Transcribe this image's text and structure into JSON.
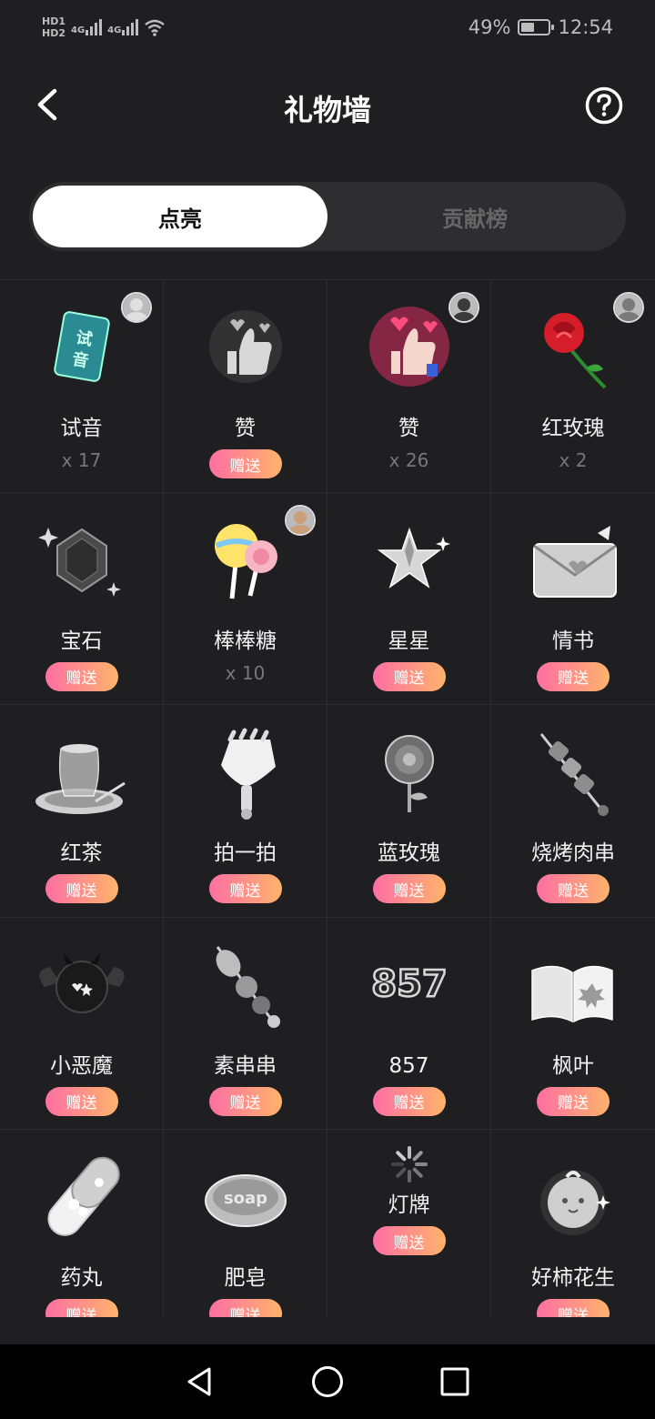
{
  "status_bar": {
    "hd1": "HD1",
    "hd2": "HD2",
    "sig1": "4G",
    "sig2": "4G",
    "battery_text": "49%",
    "battery_level": 0.49,
    "time": "12:54"
  },
  "header": {
    "title": "礼物墙",
    "back_icon": "chevron-left-icon",
    "help_icon": "question-circle-icon"
  },
  "tabs": [
    {
      "label": "点亮",
      "active": true
    },
    {
      "label": "贡献榜",
      "active": false
    }
  ],
  "send_label": "赠送",
  "gifts": [
    {
      "name": "试音",
      "count": "x 17",
      "icon": "audition-card-icon",
      "has_avatar": true
    },
    {
      "name": "赞",
      "count": "",
      "icon": "thumbs-up-gray-icon",
      "has_avatar": false
    },
    {
      "name": "赞",
      "count": "x 26",
      "icon": "thumbs-up-pink-icon",
      "has_avatar": true
    },
    {
      "name": "红玫瑰",
      "count": "x 2",
      "icon": "red-rose-icon",
      "has_avatar": true
    },
    {
      "name": "宝石",
      "count": "",
      "icon": "gem-icon",
      "has_avatar": false
    },
    {
      "name": "棒棒糖",
      "count": "x 10",
      "icon": "lollipop-icon",
      "has_avatar": true
    },
    {
      "name": "星星",
      "count": "",
      "icon": "star-icon",
      "has_avatar": false
    },
    {
      "name": "情书",
      "count": "",
      "icon": "love-letter-icon",
      "has_avatar": false
    },
    {
      "name": "红茶",
      "count": "",
      "icon": "tea-cup-icon",
      "has_avatar": false
    },
    {
      "name": "拍一拍",
      "count": "",
      "icon": "clapper-hand-icon",
      "has_avatar": false
    },
    {
      "name": "蓝玫瑰",
      "count": "",
      "icon": "blue-rose-icon",
      "has_avatar": false
    },
    {
      "name": "烧烤肉串",
      "count": "",
      "icon": "meat-skewer-icon",
      "has_avatar": false
    },
    {
      "name": "小恶魔",
      "count": "",
      "icon": "little-devil-icon",
      "has_avatar": false
    },
    {
      "name": "素串串",
      "count": "",
      "icon": "veggie-skewer-icon",
      "has_avatar": false
    },
    {
      "name": "857",
      "count": "",
      "icon": "857-text-icon",
      "has_avatar": false
    },
    {
      "name": "枫叶",
      "count": "",
      "icon": "maple-book-icon",
      "has_avatar": false
    },
    {
      "name": "药丸",
      "count": "",
      "icon": "pill-icon",
      "has_avatar": false
    },
    {
      "name": "肥皂",
      "count": "",
      "icon": "soap-icon",
      "has_avatar": false
    },
    {
      "name": "灯牌",
      "count": "",
      "icon": "loading-spinner-icon",
      "has_avatar": false
    },
    {
      "name": "好柿花生",
      "count": "",
      "icon": "persimmon-icon",
      "has_avatar": false
    }
  ],
  "nav": {
    "back": "triangle-back-icon",
    "home": "circle-home-icon",
    "recents": "square-recents-icon"
  },
  "colors": {
    "background": "#1f1f21",
    "send_gradient_start": "#ff6fa3",
    "send_gradient_end": "#ffb36b",
    "tab_active_bg": "#ffffff"
  }
}
